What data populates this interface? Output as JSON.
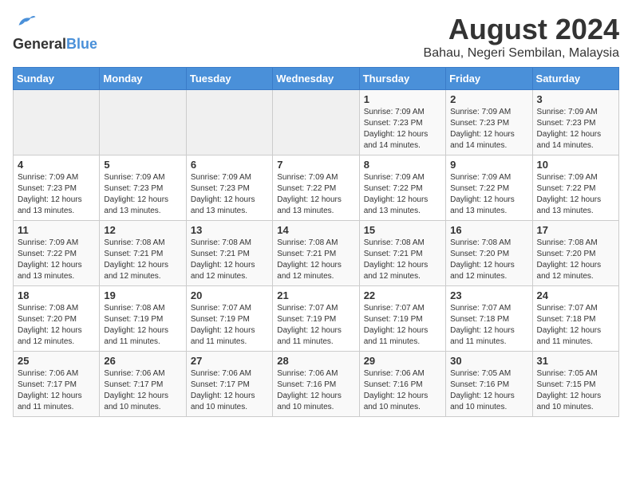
{
  "header": {
    "logo_general": "General",
    "logo_blue": "Blue",
    "title": "August 2024",
    "subtitle": "Bahau, Negeri Sembilan, Malaysia"
  },
  "days_of_week": [
    "Sunday",
    "Monday",
    "Tuesday",
    "Wednesday",
    "Thursday",
    "Friday",
    "Saturday"
  ],
  "weeks": [
    [
      {
        "day": "",
        "info": ""
      },
      {
        "day": "",
        "info": ""
      },
      {
        "day": "",
        "info": ""
      },
      {
        "day": "",
        "info": ""
      },
      {
        "day": "1",
        "info": "Sunrise: 7:09 AM\nSunset: 7:23 PM\nDaylight: 12 hours\nand 14 minutes."
      },
      {
        "day": "2",
        "info": "Sunrise: 7:09 AM\nSunset: 7:23 PM\nDaylight: 12 hours\nand 14 minutes."
      },
      {
        "day": "3",
        "info": "Sunrise: 7:09 AM\nSunset: 7:23 PM\nDaylight: 12 hours\nand 14 minutes."
      }
    ],
    [
      {
        "day": "4",
        "info": "Sunrise: 7:09 AM\nSunset: 7:23 PM\nDaylight: 12 hours\nand 13 minutes."
      },
      {
        "day": "5",
        "info": "Sunrise: 7:09 AM\nSunset: 7:23 PM\nDaylight: 12 hours\nand 13 minutes."
      },
      {
        "day": "6",
        "info": "Sunrise: 7:09 AM\nSunset: 7:23 PM\nDaylight: 12 hours\nand 13 minutes."
      },
      {
        "day": "7",
        "info": "Sunrise: 7:09 AM\nSunset: 7:22 PM\nDaylight: 12 hours\nand 13 minutes."
      },
      {
        "day": "8",
        "info": "Sunrise: 7:09 AM\nSunset: 7:22 PM\nDaylight: 12 hours\nand 13 minutes."
      },
      {
        "day": "9",
        "info": "Sunrise: 7:09 AM\nSunset: 7:22 PM\nDaylight: 12 hours\nand 13 minutes."
      },
      {
        "day": "10",
        "info": "Sunrise: 7:09 AM\nSunset: 7:22 PM\nDaylight: 12 hours\nand 13 minutes."
      }
    ],
    [
      {
        "day": "11",
        "info": "Sunrise: 7:09 AM\nSunset: 7:22 PM\nDaylight: 12 hours\nand 13 minutes."
      },
      {
        "day": "12",
        "info": "Sunrise: 7:08 AM\nSunset: 7:21 PM\nDaylight: 12 hours\nand 12 minutes."
      },
      {
        "day": "13",
        "info": "Sunrise: 7:08 AM\nSunset: 7:21 PM\nDaylight: 12 hours\nand 12 minutes."
      },
      {
        "day": "14",
        "info": "Sunrise: 7:08 AM\nSunset: 7:21 PM\nDaylight: 12 hours\nand 12 minutes."
      },
      {
        "day": "15",
        "info": "Sunrise: 7:08 AM\nSunset: 7:21 PM\nDaylight: 12 hours\nand 12 minutes."
      },
      {
        "day": "16",
        "info": "Sunrise: 7:08 AM\nSunset: 7:20 PM\nDaylight: 12 hours\nand 12 minutes."
      },
      {
        "day": "17",
        "info": "Sunrise: 7:08 AM\nSunset: 7:20 PM\nDaylight: 12 hours\nand 12 minutes."
      }
    ],
    [
      {
        "day": "18",
        "info": "Sunrise: 7:08 AM\nSunset: 7:20 PM\nDaylight: 12 hours\nand 12 minutes."
      },
      {
        "day": "19",
        "info": "Sunrise: 7:08 AM\nSunset: 7:19 PM\nDaylight: 12 hours\nand 11 minutes."
      },
      {
        "day": "20",
        "info": "Sunrise: 7:07 AM\nSunset: 7:19 PM\nDaylight: 12 hours\nand 11 minutes."
      },
      {
        "day": "21",
        "info": "Sunrise: 7:07 AM\nSunset: 7:19 PM\nDaylight: 12 hours\nand 11 minutes."
      },
      {
        "day": "22",
        "info": "Sunrise: 7:07 AM\nSunset: 7:19 PM\nDaylight: 12 hours\nand 11 minutes."
      },
      {
        "day": "23",
        "info": "Sunrise: 7:07 AM\nSunset: 7:18 PM\nDaylight: 12 hours\nand 11 minutes."
      },
      {
        "day": "24",
        "info": "Sunrise: 7:07 AM\nSunset: 7:18 PM\nDaylight: 12 hours\nand 11 minutes."
      }
    ],
    [
      {
        "day": "25",
        "info": "Sunrise: 7:06 AM\nSunset: 7:17 PM\nDaylight: 12 hours\nand 11 minutes."
      },
      {
        "day": "26",
        "info": "Sunrise: 7:06 AM\nSunset: 7:17 PM\nDaylight: 12 hours\nand 10 minutes."
      },
      {
        "day": "27",
        "info": "Sunrise: 7:06 AM\nSunset: 7:17 PM\nDaylight: 12 hours\nand 10 minutes."
      },
      {
        "day": "28",
        "info": "Sunrise: 7:06 AM\nSunset: 7:16 PM\nDaylight: 12 hours\nand 10 minutes."
      },
      {
        "day": "29",
        "info": "Sunrise: 7:06 AM\nSunset: 7:16 PM\nDaylight: 12 hours\nand 10 minutes."
      },
      {
        "day": "30",
        "info": "Sunrise: 7:05 AM\nSunset: 7:16 PM\nDaylight: 12 hours\nand 10 minutes."
      },
      {
        "day": "31",
        "info": "Sunrise: 7:05 AM\nSunset: 7:15 PM\nDaylight: 12 hours\nand 10 minutes."
      }
    ]
  ]
}
